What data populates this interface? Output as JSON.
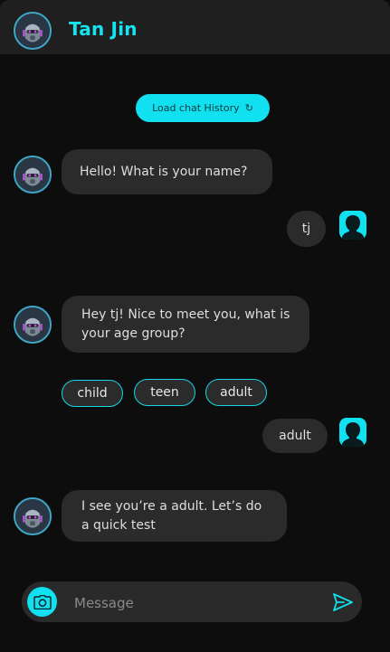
{
  "header": {
    "title": "Tan Jin",
    "avatar_icon": "robot-avatar-icon"
  },
  "load_history": {
    "label": "Load chat History",
    "icon": "refresh-icon"
  },
  "messages": [
    {
      "from": "bot",
      "text": "Hello! What is your name?"
    },
    {
      "from": "user",
      "text": "tj"
    },
    {
      "from": "bot",
      "text": "Hey tj! Nice to meet you, what is your age group?"
    },
    {
      "from": "user",
      "text": "adult"
    },
    {
      "from": "bot",
      "text": "I see you’re a adult. Let’s do a quick test"
    }
  ],
  "options": [
    "child",
    "teen",
    "adult"
  ],
  "composer": {
    "placeholder": "Message",
    "camera_icon": "camera-icon",
    "send_icon": "send-icon"
  },
  "colors": {
    "accent": "#10e0ef",
    "background": "#0d0d0d",
    "bubble": "#2b2b2b",
    "header": "#1f1f1f"
  }
}
